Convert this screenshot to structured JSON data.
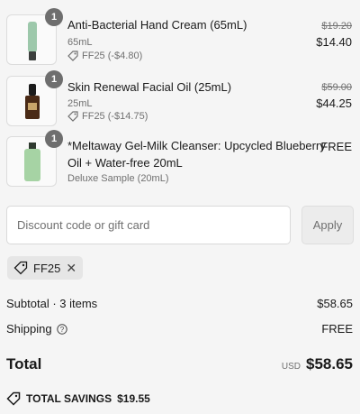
{
  "items": [
    {
      "quantity": "1",
      "name": "Anti-Bacterial Hand Cream (65mL)",
      "variant": "65mL",
      "discount": "FF25 (-$4.80)",
      "original_price": "$19.20",
      "price": "$14.40",
      "product_icon": "tube-icon",
      "colors": {
        "body": "#9dc8ab",
        "cap": "#3c3f3d"
      }
    },
    {
      "quantity": "1",
      "name": "Skin Renewal Facial Oil (25mL)",
      "variant": "25mL",
      "discount": "FF25 (-$14.75)",
      "original_price": "$59.00",
      "price": "$44.25",
      "product_icon": "dropper-bottle-icon",
      "colors": {
        "body": "#4a2a16",
        "cap": "#1b1b1b"
      }
    },
    {
      "quantity": "1",
      "name_line1": "*Meltaway Gel-Milk Cleanser: Upcycled Blueberry",
      "name_line2": "Oil + Water-free 20mL",
      "variant": "Deluxe Sample (20mL)",
      "price": "FREE",
      "product_icon": "tube-icon",
      "colors": {
        "body": "#a6d3a4",
        "cap": "#2f3a30"
      }
    }
  ],
  "discount_field": {
    "placeholder": "Discount code or gift card",
    "value": ""
  },
  "apply_label": "Apply",
  "applied_code": "FF25",
  "summary": {
    "subtotal_label": "Subtotal · 3 items",
    "subtotal_value": "$58.65",
    "shipping_label": "Shipping",
    "shipping_value": "FREE",
    "total_label": "Total",
    "currency": "USD",
    "total_value": "$58.65",
    "savings_label": "TOTAL SAVINGS",
    "savings_value": "$19.55"
  }
}
